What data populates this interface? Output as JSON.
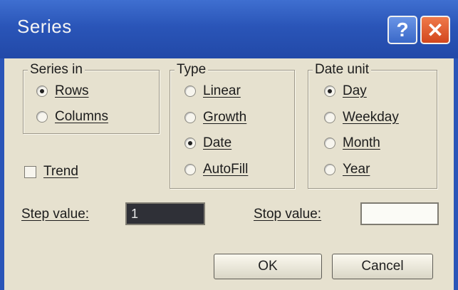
{
  "window": {
    "title": "Series",
    "help_glyph": "?",
    "close_glyph": "✕"
  },
  "series_in": {
    "legend": "Series in",
    "options": [
      {
        "label": "Rows",
        "selected": true
      },
      {
        "label": "Columns",
        "selected": false
      }
    ]
  },
  "type": {
    "legend": "Type",
    "options": [
      {
        "label": "Linear",
        "selected": false
      },
      {
        "label": "Growth",
        "selected": false
      },
      {
        "label": "Date",
        "selected": true
      },
      {
        "label": "AutoFill",
        "selected": false
      }
    ]
  },
  "date_unit": {
    "legend": "Date unit",
    "options": [
      {
        "label": "Day",
        "selected": true
      },
      {
        "label": "Weekday",
        "selected": false
      },
      {
        "label": "Month",
        "selected": false
      },
      {
        "label": "Year",
        "selected": false
      }
    ]
  },
  "trend": {
    "label": "Trend",
    "checked": false
  },
  "step": {
    "label": "Step value:",
    "value": "1"
  },
  "stop": {
    "label": "Stop value:",
    "value": ""
  },
  "buttons": {
    "ok": "OK",
    "cancel": "Cancel"
  }
}
